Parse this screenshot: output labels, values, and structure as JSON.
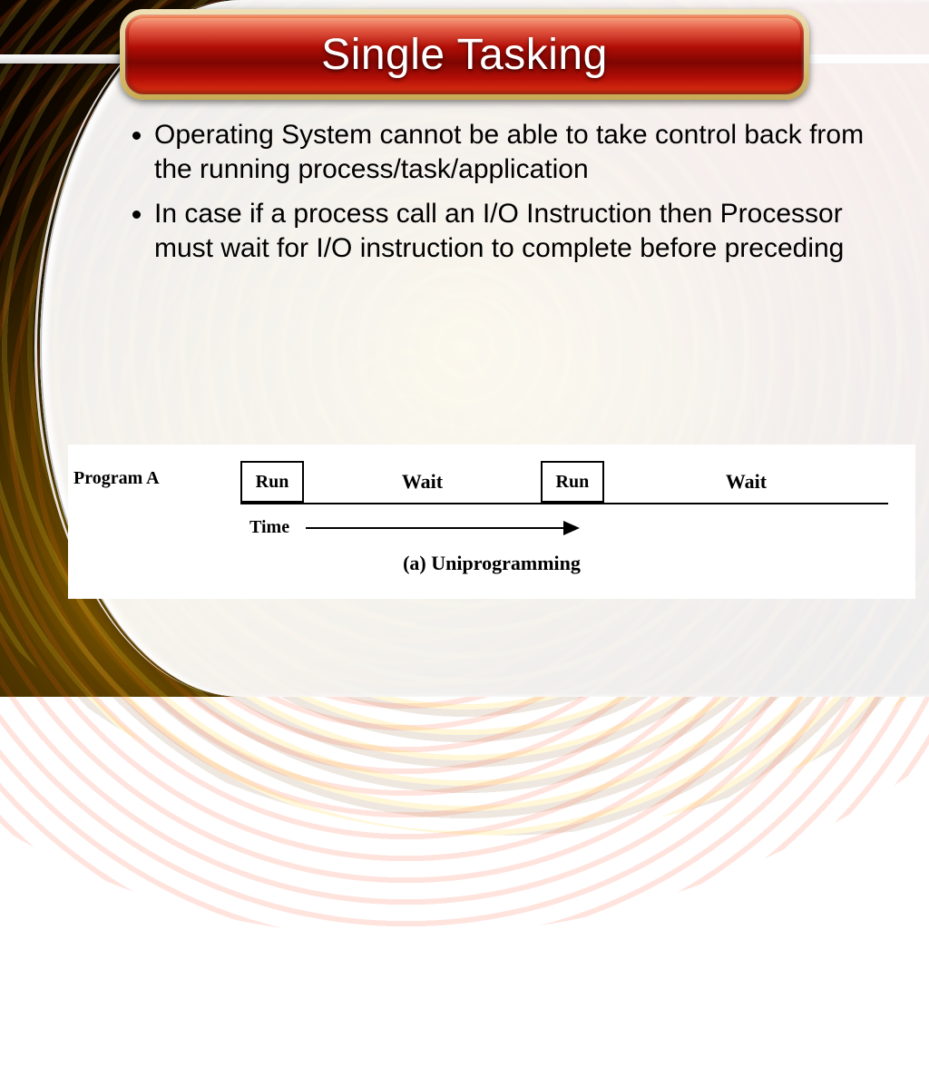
{
  "slide": {
    "title": "Single Tasking",
    "bullets": [
      "Operating System cannot be able to take control back from the running process/task/application",
      "In case if a process call an I/O Instruction then Processor must wait for I/O instruction to complete before preceding"
    ]
  },
  "diagram": {
    "program_label": "Program A",
    "segments": [
      "Run",
      "Wait",
      "Run",
      "Wait"
    ],
    "time_label": "Time",
    "caption": "(a) Uniprogramming"
  }
}
